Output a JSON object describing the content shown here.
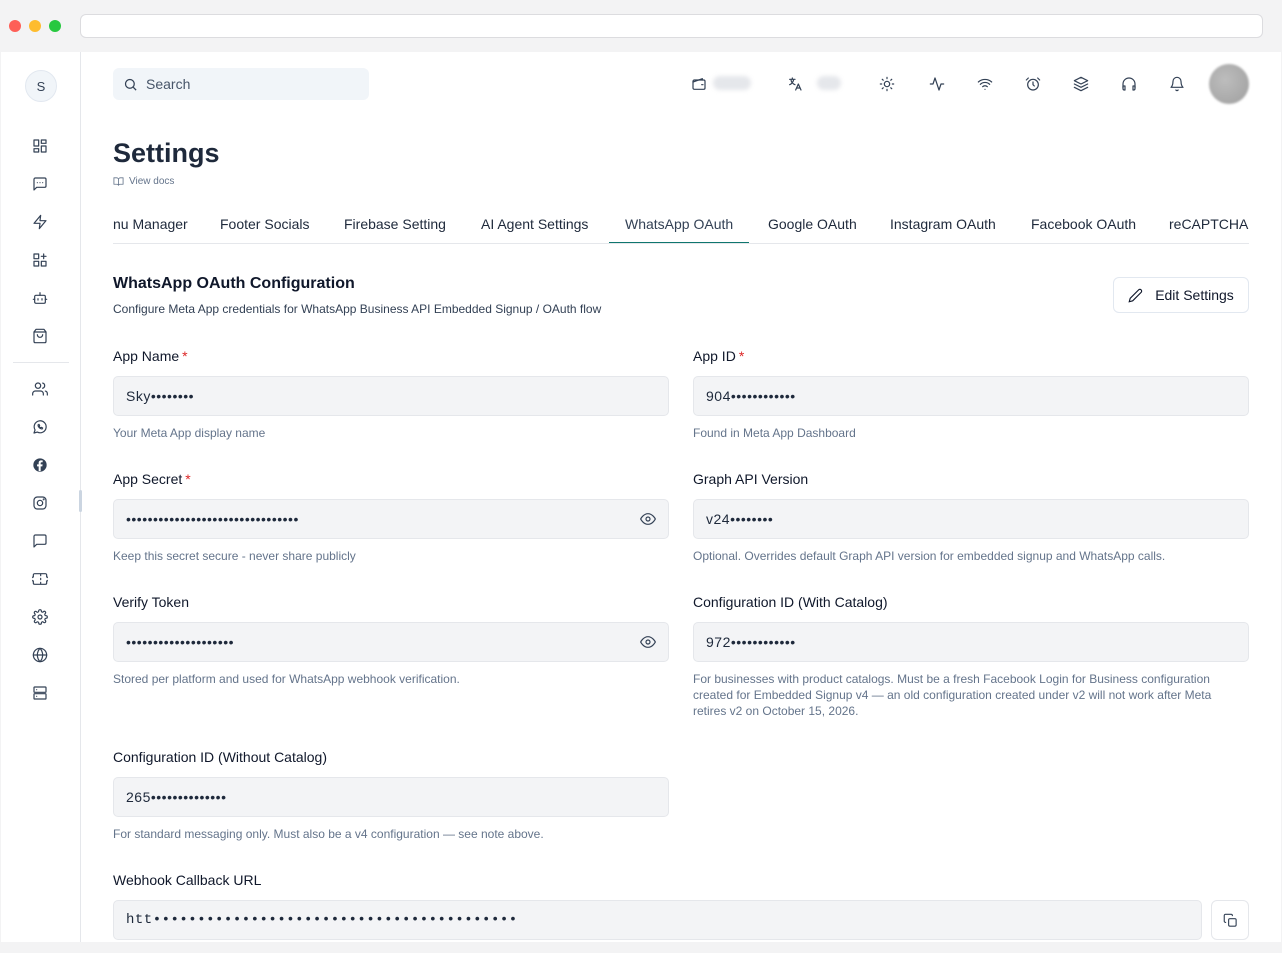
{
  "sidebar": {
    "avatar_initial": "S",
    "icons": [
      "dashboard-icon",
      "message-square-icon",
      "zap-icon",
      "apps-add-icon",
      "bot-icon",
      "shopping-bag-icon",
      "users-icon",
      "whatsapp-icon",
      "facebook-icon",
      "instagram-icon",
      "chat-bubble-icon",
      "ticket-icon",
      "settings-gear-icon",
      "globe-icon",
      "server-icon"
    ]
  },
  "header": {
    "search_placeholder": "Search",
    "icons": [
      "wallet-icon",
      "translate-icon",
      "sun-icon",
      "activity-icon",
      "wifi-icon",
      "alarm-clock-icon",
      "layers-icon",
      "headphones-icon",
      "bell-icon"
    ]
  },
  "page": {
    "title": "Settings",
    "docs_link": "View docs"
  },
  "tabs": [
    {
      "label": "nu Manager"
    },
    {
      "label": "Footer Socials"
    },
    {
      "label": "Firebase Setting"
    },
    {
      "label": "AI Agent Settings"
    },
    {
      "label": "WhatsApp OAuth"
    },
    {
      "label": "Google OAuth"
    },
    {
      "label": "Instagram OAuth"
    },
    {
      "label": "Facebook OAuth"
    },
    {
      "label": "reCAPTCHA"
    }
  ],
  "active_tab": "WhatsApp OAuth",
  "section": {
    "title": "WhatsApp OAuth Configuration",
    "description": "Configure Meta App credentials for WhatsApp Business API Embedded Signup / OAuth flow",
    "edit_button": "Edit Settings"
  },
  "fields": {
    "app_name": {
      "label": "App Name",
      "required": "*",
      "value": "Sky••••••••",
      "help": "Your Meta App display name"
    },
    "app_id": {
      "label": "App ID",
      "required": "*",
      "value": "904••••••••••••",
      "help": "Found in Meta App Dashboard"
    },
    "app_secret": {
      "label": "App Secret",
      "required": "*",
      "value": "••••••••••••••••••••••••••••••••",
      "help": "Keep this secret secure - never share publicly"
    },
    "graph_api_version": {
      "label": "Graph API Version",
      "value": "v24••••••••",
      "help": "Optional. Overrides default Graph API version for embedded signup and WhatsApp calls."
    },
    "verify_token": {
      "label": "Verify Token",
      "value": "••••••••••••••••••••",
      "help": "Stored per platform and used for WhatsApp webhook verification."
    },
    "config_id_with_catalog": {
      "label": "Configuration ID (With Catalog)",
      "value": "972••••••••••••",
      "help": "For businesses with product catalogs. Must be a fresh Facebook Login for Business configuration created for Embedded Signup v4 — an old configuration created under v2 will not work after Meta retires v2 on October 15, 2026."
    },
    "config_id_without_catalog": {
      "label": "Configuration ID (Without Catalog)",
      "value": "265••••••••••••••",
      "help": "For standard messaging only. Must also be a v4 configuration — see note above."
    },
    "webhook_callback_url": {
      "label": "Webhook Callback URL",
      "value": "htt•••••••••••••••••••••••••••••••••••••••••"
    }
  }
}
